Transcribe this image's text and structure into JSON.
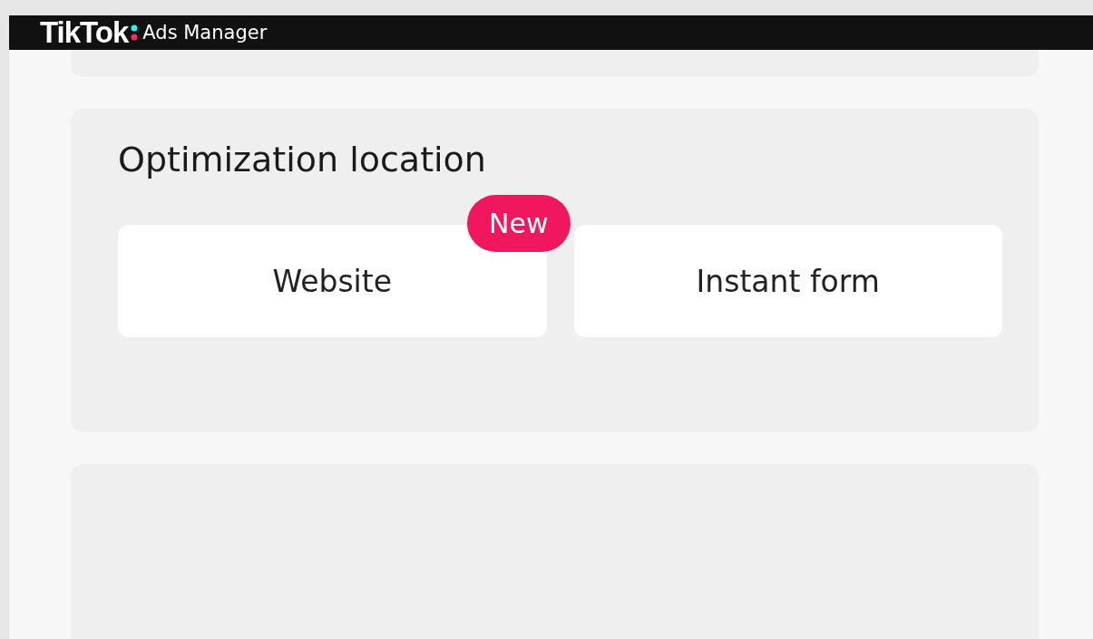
{
  "header": {
    "brand": "TikTok",
    "product": "Ads Manager"
  },
  "section": {
    "title": "Optimization location",
    "options": [
      {
        "label": "Website",
        "badge": "New"
      },
      {
        "label": "Instant form"
      }
    ]
  }
}
